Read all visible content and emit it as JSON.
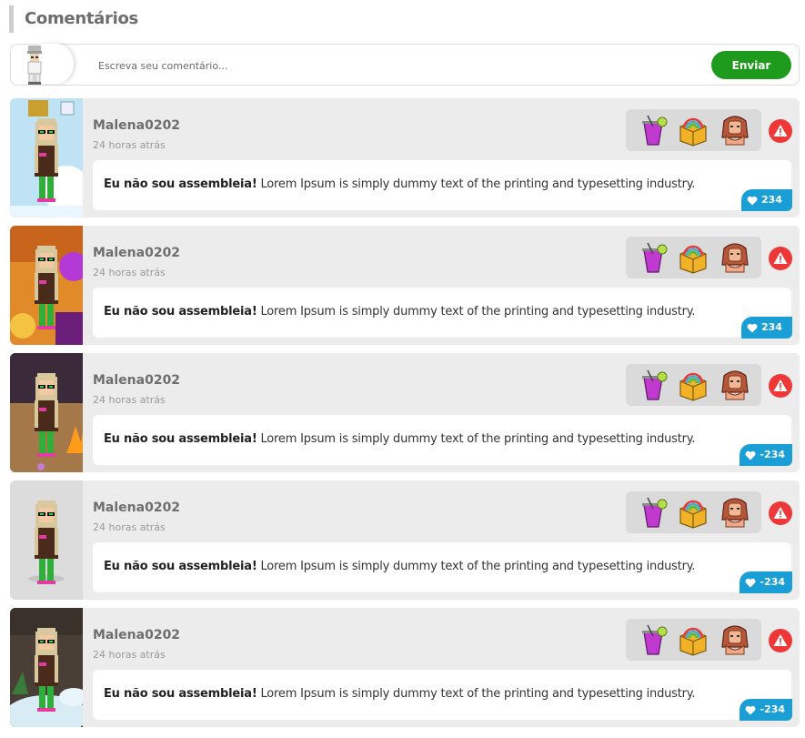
{
  "section": {
    "title": "Comentários"
  },
  "compose": {
    "placeholder": "Escreva seu comentário...",
    "send_label": "Enviar"
  },
  "comments": [
    {
      "user": "Malena0202",
      "time": "24 horas atrás",
      "bold": "Eu não sou assembleia!",
      "text": " Lorem Ipsum is simply dummy text of the printing and typesetting industry.",
      "likes": "234",
      "bg": "snow"
    },
    {
      "user": "Malena0202",
      "time": "24 horas atrás",
      "bold": "Eu não sou assembleia!",
      "text": " Lorem Ipsum is simply dummy text of the printing and typesetting industry.",
      "likes": "234",
      "bg": "party"
    },
    {
      "user": "Malena0202",
      "time": "24 horas atrás",
      "bold": "Eu não sou assembleia!",
      "text": " Lorem Ipsum is simply dummy text of the printing and typesetting industry.",
      "likes": "-234",
      "bg": "campfire"
    },
    {
      "user": "Malena0202",
      "time": "24 horas atrás",
      "bold": "Eu não sou assembleia!",
      "text": " Lorem Ipsum is simply dummy text of the printing and typesetting industry.",
      "likes": "-234",
      "bg": "plain"
    },
    {
      "user": "Malena0202",
      "time": "24 horas atrás",
      "bold": "Eu não sou assembleia!",
      "text": " Lorem Ipsum is simply dummy text of the printing and typesetting industry.",
      "likes": "-234",
      "bg": "clouds"
    }
  ],
  "badges": [
    "drink-badge-icon",
    "rainbow-box-badge-icon",
    "mermaid-badge-icon"
  ],
  "colors": {
    "send": "#1e9a1c",
    "likes": "#1a9ed6",
    "report": "#ee3737",
    "card": "#ececec"
  }
}
